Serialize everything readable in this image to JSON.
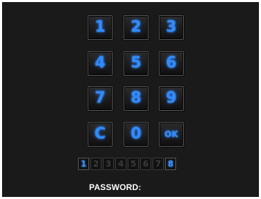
{
  "keypad": {
    "keys": [
      {
        "label": "1"
      },
      {
        "label": "2"
      },
      {
        "label": "3"
      },
      {
        "label": "4"
      },
      {
        "label": "5"
      },
      {
        "label": "6"
      },
      {
        "label": "7"
      },
      {
        "label": "8"
      },
      {
        "label": "9"
      },
      {
        "label": "C"
      },
      {
        "label": "0"
      },
      {
        "label": "OK"
      }
    ]
  },
  "slots": {
    "items": [
      {
        "label": "1",
        "active": true
      },
      {
        "label": "2",
        "active": false
      },
      {
        "label": "3",
        "active": false
      },
      {
        "label": "4",
        "active": false
      },
      {
        "label": "5",
        "active": false
      },
      {
        "label": "6",
        "active": false
      },
      {
        "label": "7",
        "active": false
      },
      {
        "label": "8",
        "active": true
      }
    ]
  },
  "password": {
    "label": "PASSWORD:",
    "value": ""
  },
  "colors": {
    "background": "#1a1a1a",
    "accent": "#2f8cff",
    "inactive_slot": "#3b3b3b",
    "label": "#ffffff"
  }
}
